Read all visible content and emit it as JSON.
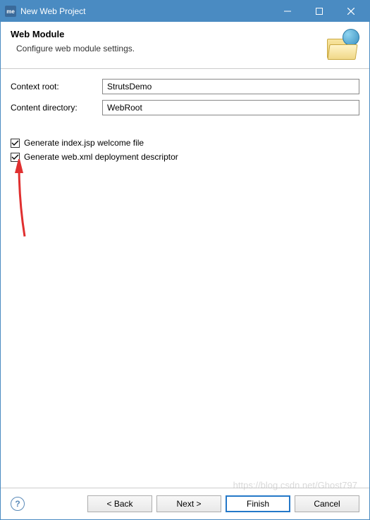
{
  "titlebar": {
    "icon_text": "me",
    "title": "New Web Project"
  },
  "header": {
    "title": "Web Module",
    "description": "Configure web module settings."
  },
  "form": {
    "context_root_label": "Context root:",
    "context_root_value": "StrutsDemo",
    "content_dir_label": "Content directory:",
    "content_dir_value": "WebRoot"
  },
  "checkboxes": {
    "generate_index": {
      "label": "Generate index.jsp welcome file",
      "checked": true
    },
    "generate_webxml": {
      "label": "Generate web.xml deployment descriptor",
      "checked": true
    }
  },
  "footer": {
    "back": "< Back",
    "next": "Next >",
    "finish": "Finish",
    "cancel": "Cancel"
  },
  "watermark": "https://blog.csdn.net/Ghost797",
  "annotation": {
    "arrow_color": "#e03030"
  }
}
